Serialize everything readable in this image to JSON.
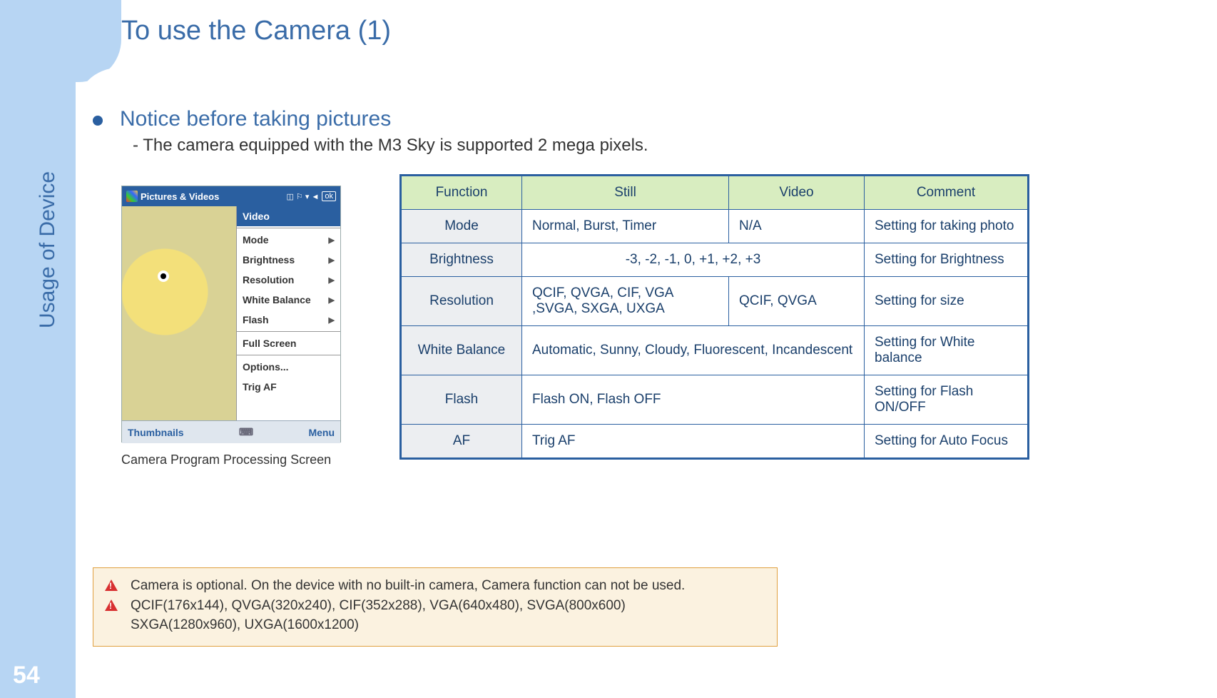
{
  "page_number": "54",
  "side_label": "Usage of Device",
  "title": "To use the Camera (1)",
  "bullet_title": "Notice before taking pictures",
  "bullet_sub": "- The camera equipped with the M3 Sky is supported 2 mega pixels.",
  "screenshot": {
    "header_title": "Pictures & Videos",
    "ok": "ok",
    "menu": {
      "video": "Video",
      "mode": "Mode",
      "brightness": "Brightness",
      "resolution": "Resolution",
      "white_balance": "White Balance",
      "flash": "Flash",
      "full_screen": "Full Screen",
      "options": "Options...",
      "trig_af": "Trig AF"
    },
    "bottom_left": "Thumbnails",
    "bottom_right": "Menu",
    "caption": "Camera Program Processing Screen"
  },
  "table": {
    "headers": {
      "function": "Function",
      "still": "Still",
      "video": "Video",
      "comment": "Comment"
    },
    "rows": [
      {
        "function": "Mode",
        "still": "Normal, Burst, Timer",
        "video": "N/A",
        "comment": "Setting for taking photo"
      },
      {
        "function": "Brightness",
        "merged": "-3, -2, -1, 0, +1, +2, +3",
        "comment": "Setting for Brightness"
      },
      {
        "function": "Resolution",
        "still": "QCIF, QVGA, CIF, VGA ,SVGA, SXGA, UXGA",
        "video": "QCIF, QVGA",
        "comment": "Setting for size"
      },
      {
        "function": "White Balance",
        "merged": "Automatic, Sunny, Cloudy, Fluorescent, Incandescent",
        "comment": "Setting for White balance"
      },
      {
        "function": "Flash",
        "merged": "Flash ON,  Flash OFF",
        "comment": "Setting for Flash ON/OFF"
      },
      {
        "function": "AF",
        "merged": "Trig AF",
        "comment": "Setting for Auto Focus"
      }
    ]
  },
  "warnings": {
    "line1": "Camera is optional. On the device with no built-in camera, Camera function can not be used.",
    "line2": "QCIF(176x144), QVGA(320x240), CIF(352x288), VGA(640x480), SVGA(800x600)",
    "line3": "SXGA(1280x960), UXGA(1600x1200)"
  }
}
